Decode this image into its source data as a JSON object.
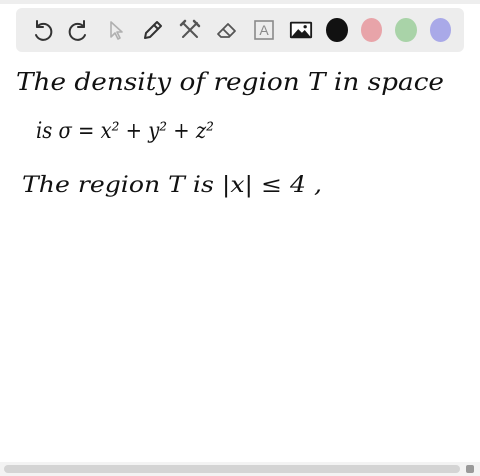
{
  "toolbar": {
    "tools": [
      {
        "name": "undo-icon"
      },
      {
        "name": "redo-icon"
      },
      {
        "name": "pointer-icon"
      },
      {
        "name": "pen-icon"
      },
      {
        "name": "tools-icon"
      },
      {
        "name": "eraser-icon"
      },
      {
        "name": "text-icon",
        "glyph": "A"
      },
      {
        "name": "image-icon"
      }
    ],
    "colors": [
      "#111111",
      "#e8a4a9",
      "#a9d3a8",
      "#a9a9e8"
    ]
  },
  "canvas": {
    "lines": [
      "The density of region T in space",
      "is σ = x² + y² + z²",
      "The region T is |x| ≤ 4 ,"
    ]
  },
  "ink_color": "#111111"
}
